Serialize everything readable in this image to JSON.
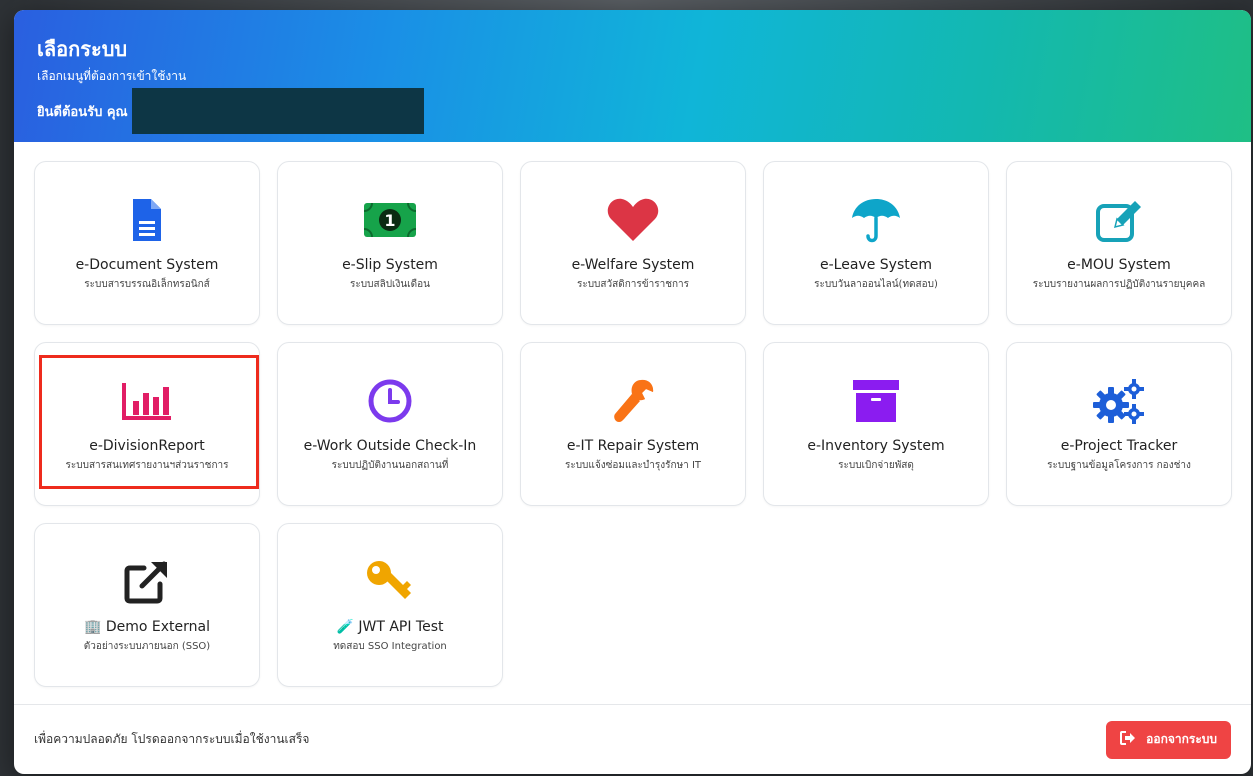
{
  "header": {
    "title": "เลือกระบบ",
    "subtitle": "เลือกเมนูที่ต้องการเข้าใช้งาน",
    "welcome": "ยินดีต้อนรับ คุณ"
  },
  "cards": [
    {
      "title": "e-Document System",
      "desc": "ระบบสารบรรณอิเล็กทรอนิกส์",
      "icon": "document-icon",
      "color": "#1e63e8"
    },
    {
      "title": "e-Slip System",
      "desc": "ระบบสลิปเงินเดือน",
      "icon": "money-bill-icon",
      "color": "#16a34a"
    },
    {
      "title": "e-Welfare System",
      "desc": "ระบบสวัสดิการข้าราชการ",
      "icon": "heart-icon",
      "color": "#dc3545"
    },
    {
      "title": "e-Leave System",
      "desc": "ระบบวันลาออนไลน์(ทดสอบ)",
      "icon": "umbrella-icon",
      "color": "#0ea5c9"
    },
    {
      "title": "e-MOU System",
      "desc": "ระบบรายงานผลการปฏิบัติงานรายบุคคล",
      "icon": "edit-square-icon",
      "color": "#17a2b8"
    },
    {
      "title": "e-DivisionReport",
      "desc": "ระบบสารสนเทศรายงานฯส่วนราชการ",
      "icon": "bar-chart-icon",
      "color": "#e11d65"
    },
    {
      "title": "e-Work Outside Check-In",
      "desc": "ระบบปฏิบัติงานนอกสถานที่",
      "icon": "clock-icon",
      "color": "#7c3aed"
    },
    {
      "title": "e-IT Repair System",
      "desc": "ระบบแจ้งซ่อมและบำรุงรักษา IT",
      "icon": "wrench-icon",
      "color": "#f97316"
    },
    {
      "title": "e-Inventory System",
      "desc": "ระบบเบิกจ่ายพัสดุ",
      "icon": "archive-box-icon",
      "color": "#8b1cf0"
    },
    {
      "title": "e-Project Tracker",
      "desc": "ระบบฐานข้อมูลโครงการ กองช่าง",
      "icon": "gears-icon",
      "color": "#1d5ed8"
    },
    {
      "title": "Demo External",
      "title_prefix": "🏢",
      "desc": "ตัวอย่างระบบภายนอก (SSO)",
      "icon": "external-link-icon",
      "color": "#222222"
    },
    {
      "title": "JWT API Test",
      "title_prefix": "🧪",
      "desc": "ทดสอบ SSO Integration",
      "icon": "key-icon",
      "color": "#f0a500"
    }
  ],
  "footer": {
    "note": "เพื่อความปลอดภัย โปรดออกจากระบบเมื่อใช้งานเสร็จ",
    "logout_label": "ออกจากระบบ"
  },
  "colors": {
    "logout": "#ef4444",
    "selection_outline": "#ee2b1d"
  }
}
